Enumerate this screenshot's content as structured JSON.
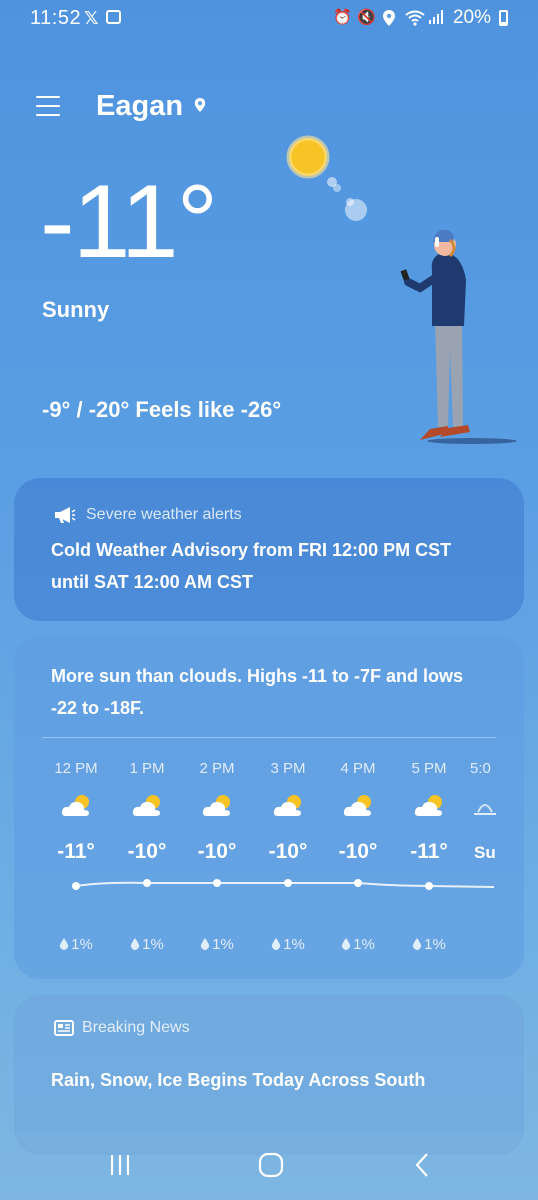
{
  "status_bar": {
    "time": "11:52",
    "battery": "20%",
    "icons": [
      "x-icon",
      "gallery-icon",
      "alarm-icon",
      "mute-icon",
      "location-icon",
      "wifi-icon",
      "signal-icon",
      "battery-icon"
    ]
  },
  "header": {
    "city": "Eagan"
  },
  "current": {
    "temp": "-11°",
    "condition": "Sunny",
    "hilo": "-9° / -20° Feels like -26°"
  },
  "alert": {
    "heading": "Severe weather alerts",
    "text": "Cold Weather Advisory from FRI 12:00 PM CST until SAT 12:00 AM CST"
  },
  "forecast": {
    "summary": "More sun than clouds. Highs -11 to -7F and lows -22 to -18F.",
    "hours": [
      {
        "label": "12 PM",
        "temp": "-11°",
        "precip": "1%",
        "icon": "partly-sunny-icon"
      },
      {
        "label": "1 PM",
        "temp": "-10°",
        "precip": "1%",
        "icon": "partly-sunny-icon"
      },
      {
        "label": "2 PM",
        "temp": "-10°",
        "precip": "1%",
        "icon": "partly-sunny-icon"
      },
      {
        "label": "3 PM",
        "temp": "-10°",
        "precip": "1%",
        "icon": "partly-sunny-icon"
      },
      {
        "label": "4 PM",
        "temp": "-10°",
        "precip": "1%",
        "icon": "partly-sunny-icon"
      },
      {
        "label": "5 PM",
        "temp": "-11°",
        "precip": "1%",
        "icon": "partly-sunny-icon"
      },
      {
        "label": "5:0",
        "temp": "Su",
        "precip": "",
        "icon": "sunset-icon"
      }
    ]
  },
  "news": {
    "heading": "Breaking News",
    "headline": "Rain, Snow, Ice Begins Today Across South"
  },
  "nav": {
    "icons": [
      "recent-apps-icon",
      "home-icon",
      "back-icon"
    ]
  },
  "colors": {
    "background": "#5a9ee3",
    "sun": "#f7c325",
    "card_alert": "#4a88d6"
  }
}
